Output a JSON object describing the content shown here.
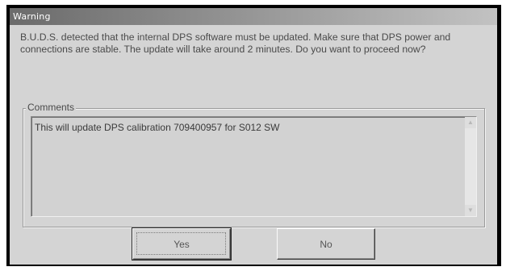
{
  "dialog": {
    "title": "Warning",
    "message": "B.U.D.S. detected that the internal DPS software must be updated. Make sure that DPS power and connections are stable. The update will take around 2 minutes. Do you want to proceed now?",
    "comments_label": "Comments",
    "comments_text": "This will update DPS calibration 709400957 for S012 SW",
    "yes_label": "Yes",
    "no_label": "No"
  },
  "icons": {
    "scroll_up": "scroll-up-arrow-icon",
    "scroll_down": "scroll-down-arrow-icon"
  }
}
